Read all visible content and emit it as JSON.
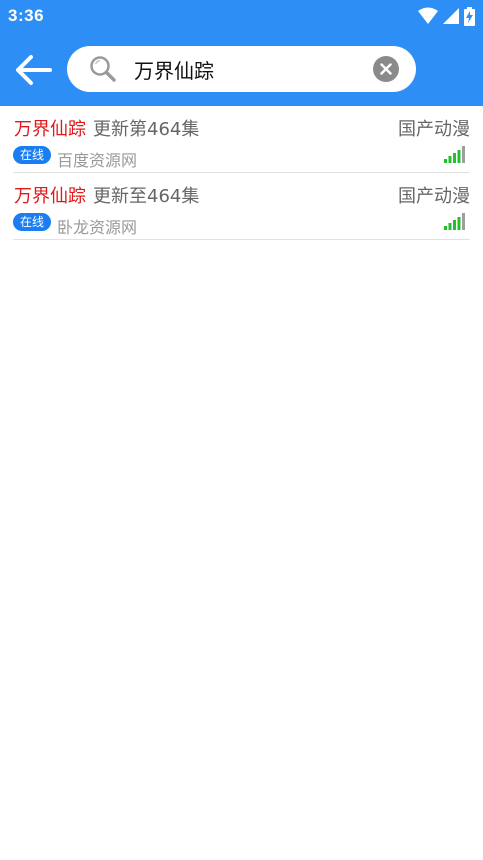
{
  "status_bar": {
    "time": "3:36",
    "icons": [
      "wifi-icon",
      "cell-signal-icon",
      "battery-charging-icon"
    ]
  },
  "header": {
    "search": {
      "value": "万界仙踪",
      "placeholder": ""
    },
    "icons": {
      "back": "back-arrow-icon",
      "search": "search-icon",
      "clear": "clear-icon"
    }
  },
  "results": [
    {
      "title": "万界仙踪",
      "update": "更新第464集",
      "category": "国产动漫",
      "badge": "在线",
      "source": "百度资源网",
      "signal_bars": 5
    },
    {
      "title": "万界仙踪",
      "update": "更新至464集",
      "category": "国产动漫",
      "badge": "在线",
      "source": "卧龙资源网",
      "signal_bars": 5
    }
  ],
  "colors": {
    "header_bg": "#2d8ff5",
    "title_red": "#e0191b",
    "badge_blue": "#1a7ef2",
    "signal_green": "#22c02a",
    "signal_gray": "#9e9e9e"
  }
}
